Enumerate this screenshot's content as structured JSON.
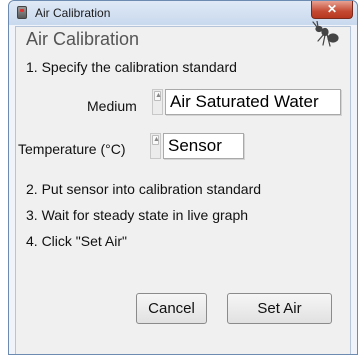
{
  "window": {
    "title": "Air Calibration",
    "close_label": "✕"
  },
  "dialog": {
    "heading": "Air Calibration",
    "steps": [
      "1. Specify the calibration standard",
      "2. Put sensor into calibration standard",
      "3. Wait for steady state in live graph",
      "4. Click \"Set Air\""
    ],
    "medium": {
      "label": "Medium",
      "value": "Air Saturated Water"
    },
    "temperature": {
      "label": "Temperature (°C)",
      "value": "Sensor"
    },
    "buttons": {
      "cancel": "Cancel",
      "set_air": "Set Air"
    },
    "logo_icon": "ant-icon"
  }
}
